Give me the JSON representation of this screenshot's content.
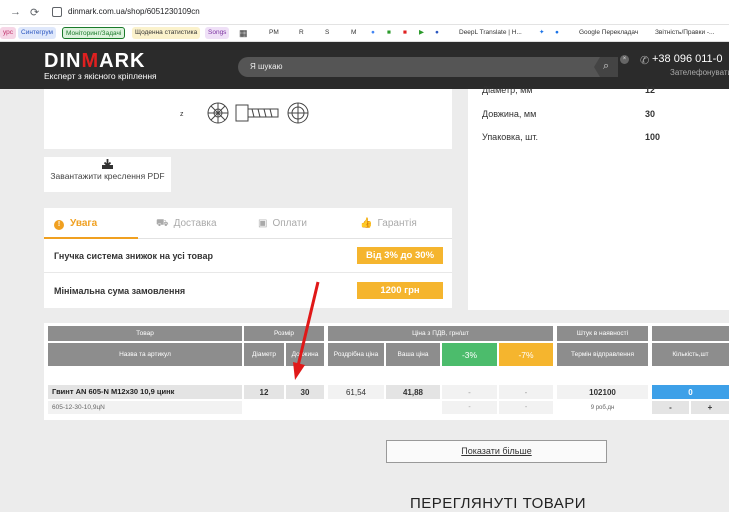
{
  "browser": {
    "url": "dinmark.com.ua/shop/6051230109cn",
    "bookmarks": [
      "урс",
      "Синтегрум",
      "Моніторинг/Задачі",
      "Щоденна статистика",
      "Songs",
      "PM",
      "R",
      "S",
      "M",
      "DeepL Translate | H...",
      "Google Перекладач",
      "Звітність/Правки -..."
    ]
  },
  "header": {
    "logo_part1": "DIN",
    "logo_part2": "M",
    "logo_part3": "ARK",
    "tagline": "Експерт з якісного кріплення",
    "search_placeholder": "Я шукаю",
    "phone": "+38 096 011-0",
    "callback": "Зателефонувати"
  },
  "specs": [
    {
      "label": "Діаметр, мм",
      "value": "12"
    },
    {
      "label": "Довжина, мм",
      "value": "30"
    },
    {
      "label": "Упаковка, шт.",
      "value": "100"
    }
  ],
  "pdf": {
    "label": "Завантажити креслення PDF"
  },
  "tabs": [
    {
      "label": "Увага",
      "icon": "warning-icon"
    },
    {
      "label": "Доставка",
      "icon": "truck-icon"
    },
    {
      "label": "Оплати",
      "icon": "wallet-icon"
    },
    {
      "label": "Гарантія",
      "icon": "thumbs-up-icon"
    }
  ],
  "promos": [
    {
      "text": "Гнучка система знижок на усі товар",
      "badge": "Від 3% до 30%"
    },
    {
      "text": "Мінімальна сума замовлення",
      "badge": "1200 грн"
    }
  ],
  "table": {
    "groups": {
      "product": "Товар",
      "size": "Розмір",
      "price": "Ціна з ПДВ, грн/шт",
      "stock": "Штук в наявності"
    },
    "cols": {
      "name": "Назва та артикул",
      "diameter": "Діаметр",
      "length": "Довжина",
      "retail": "Роздрібна ціна",
      "your": "Ваша ціна",
      "disc3": "-3%",
      "disc7": "-7%",
      "term": "Термін відправлення",
      "qty": "Кількість,шт"
    },
    "row": {
      "name": "Гвинт AN 605-N M12x30 10,9 цинк",
      "article": "605-12-30-10,9цN",
      "diameter": "12",
      "length": "30",
      "retail": "61,54",
      "your": "41,88",
      "disc3": "-",
      "disc7": "-",
      "disc3b": "-",
      "disc7b": "-",
      "stock": "102100",
      "term": "9 роб.дн",
      "qty": "0",
      "minus": "-",
      "plus": "+"
    }
  },
  "more_button": "Показати більше",
  "viewed_title": "ПЕРЕГЛЯНУТІ ТОВАРИ",
  "colors": {
    "accent": "#f0a020",
    "red": "#e02020",
    "green": "#4cbc6c",
    "orange": "#f5b52e",
    "blue": "#3da0e8"
  }
}
